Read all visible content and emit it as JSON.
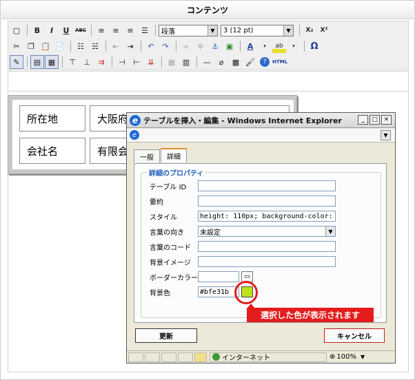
{
  "editor": {
    "title": "コンテンツ",
    "toolbar": {
      "format_select": "段落",
      "size_select": "3 (12 pt)",
      "bold": "B",
      "italic": "I",
      "underline": "U",
      "strike": "ABC",
      "subscript": "X₂",
      "superscript": "X²",
      "omega": "Ω",
      "html": "HTML"
    }
  },
  "table": {
    "cells": [
      "所在地",
      "大阪府堺市",
      "会社名",
      "有限会"
    ]
  },
  "dialog": {
    "title": "テーブルを挿入・編集 - Windows Internet Explorer",
    "tabs": [
      "一般",
      "詳細"
    ],
    "legend": "詳細のプロパティ",
    "fields": {
      "table_id": {
        "label": "テーブル ID",
        "value": ""
      },
      "summary": {
        "label": "要約",
        "value": ""
      },
      "style": {
        "label": "スタイル",
        "value": "height: 110px; background-color: #"
      },
      "direction": {
        "label": "言葉の向き",
        "value": "未設定"
      },
      "lang_code": {
        "label": "言葉のコード",
        "value": ""
      },
      "bg_image": {
        "label": "背景イメージ",
        "value": ""
      },
      "border_color": {
        "label": "ボーダーカラー",
        "value": ""
      },
      "bg_color": {
        "label": "背景色",
        "value": "#bfe31b"
      }
    },
    "buttons": {
      "update": "更新",
      "cancel": "キャンセル"
    },
    "status": {
      "zone": "インターネット",
      "zoom": "100%"
    }
  },
  "annotation": {
    "callout": "選択した色が表示されます"
  },
  "colors": {
    "bg_swatch": "#bfe31b",
    "callout": "#e41c1c",
    "legend": "#1d5cb5"
  }
}
